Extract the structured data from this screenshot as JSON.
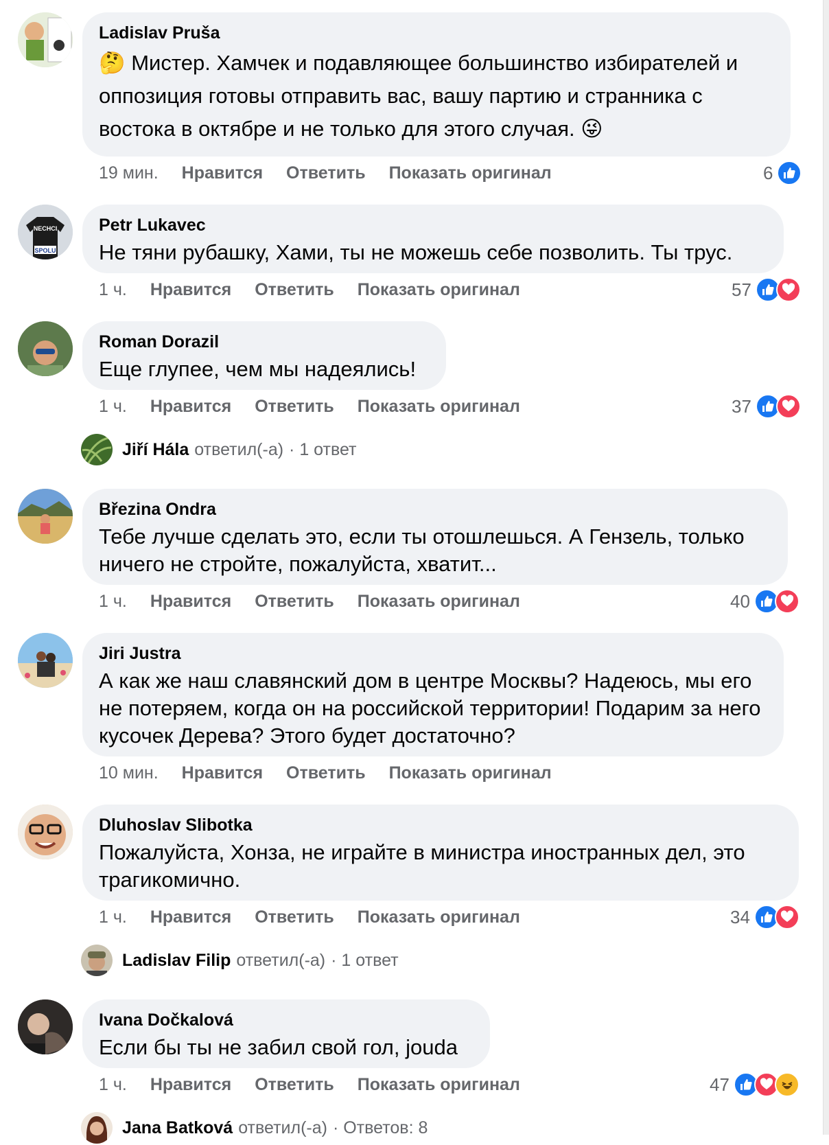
{
  "comments": [
    {
      "author": "Ladislav Pruša",
      "text_emoji_before": "🤔",
      "text": "Мистер. Хамчек и подавляющее большинство избирателей и оппозиция готовы отправить вас, вашу партию и странника с востока в октябре и не только для этого случая.",
      "text_emoji_after": "😜",
      "time": "19 мин.",
      "like": "Нравится",
      "reply": "Ответить",
      "show_original": "Показать оригинал",
      "reaction_count": "6",
      "reactions": [
        "like"
      ]
    },
    {
      "author": "Petr Lukavec",
      "text": "Не тяни рубашку, Хами, ты не можешь себе позволить. Ты трус.",
      "time": "1 ч.",
      "like": "Нравится",
      "reply": "Ответить",
      "show_original": "Показать оригинал",
      "reaction_count": "57",
      "reactions": [
        "like",
        "love"
      ]
    },
    {
      "author": "Roman Dorazil",
      "text": "Еще глупее, чем мы надеялись!",
      "time": "1 ч.",
      "like": "Нравится",
      "reply": "Ответить",
      "show_original": "Показать оригинал",
      "reaction_count": "37",
      "reactions": [
        "like",
        "love"
      ],
      "replies_summary": {
        "name": "Jiří Hála",
        "verb": "ответил(-а)",
        "count": "· 1 ответ"
      }
    },
    {
      "author": "Březina Ondra",
      "text": "Тебе лучше сделать это, если ты отошлешься. А Гензель, только ничего не стройте, пожалуйста, хватит...",
      "time": "1 ч.",
      "like": "Нравится",
      "reply": "Ответить",
      "show_original": "Показать оригинал",
      "reaction_count": "40",
      "reactions": [
        "like",
        "love"
      ]
    },
    {
      "author": "Jiri Justra",
      "text": "А как же наш славянский дом в центре Москвы? Надеюсь, мы его не потеряем, когда он на российской территории! Подарим за него кусочек Дерева? Этого будет достаточно?",
      "time": "10 мин.",
      "like": "Нравится",
      "reply": "Ответить",
      "show_original": "Показать оригинал"
    },
    {
      "author": "Dluhoslav Slibotka",
      "text": "Пожалуйста, Хонза, не играйте в министра иностранных дел, это трагикомично.",
      "time": "1 ч.",
      "like": "Нравится",
      "reply": "Ответить",
      "show_original": "Показать оригинал",
      "reaction_count": "34",
      "reactions": [
        "like",
        "love"
      ],
      "replies_summary": {
        "name": "Ladislav Filip",
        "verb": "ответил(-а)",
        "count": "· 1 ответ"
      }
    },
    {
      "author": "Ivana Dočkalová",
      "text": "Если бы ты не забил свой гол, jouda",
      "time": "1 ч.",
      "like": "Нравится",
      "reply": "Ответить",
      "show_original": "Показать оригинал",
      "reaction_count": "47",
      "reactions": [
        "like",
        "love",
        "haha"
      ],
      "replies_summary": {
        "name": "Jana Batková",
        "verb": "ответил(-а)",
        "count": "· Ответов: 8"
      }
    }
  ],
  "avatar_shirt_text": {
    "top": "NECHCI",
    "bottom": "SPOLU"
  },
  "colors": {
    "bubble": "#f0f2f5",
    "like": "#1877f2",
    "love": "#f33e58",
    "haha": "#f7b928",
    "meta": "#65676b"
  }
}
